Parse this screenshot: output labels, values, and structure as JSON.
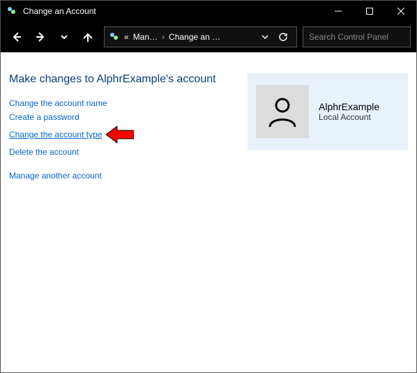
{
  "window": {
    "title": "Change an Account"
  },
  "toolbar": {
    "breadcrumb_prefix": "«",
    "breadcrumb1": "Man…",
    "breadcrumb2": "Change an …",
    "search_placeholder": "Search Control Panel"
  },
  "page": {
    "title": "Make changes to AlphrExample's account"
  },
  "actions": {
    "change_name": "Change the account name",
    "create_password": "Create a password",
    "change_type": "Change the account type",
    "delete_account": "Delete the account",
    "manage_another": "Manage another account"
  },
  "account": {
    "name": "AlphrExample",
    "type": "Local Account"
  }
}
